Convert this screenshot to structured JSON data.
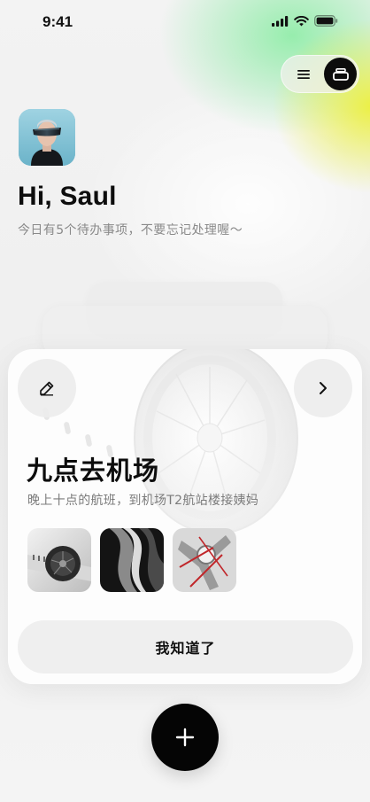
{
  "status_bar": {
    "time": "9:41"
  },
  "header": {
    "greeting": "Hi, Saul",
    "subtitle": "今日有5个待办事项，不要忘记处理喔～"
  },
  "icons": {
    "list": "list-icon",
    "card": "card-stack-icon",
    "edit": "pencil-icon",
    "next": "chevron-right-icon",
    "add": "plus-icon"
  },
  "task": {
    "title": "九点去机场",
    "description": "晚上十点的航班，到机场T2航站楼接姨妈",
    "acknowledge_label": "我知道了"
  },
  "colors": {
    "primary": "#050505",
    "accent_green": "#78eb96",
    "accent_yellow": "#ebf03c",
    "text_secondary": "#8a8a8a"
  }
}
